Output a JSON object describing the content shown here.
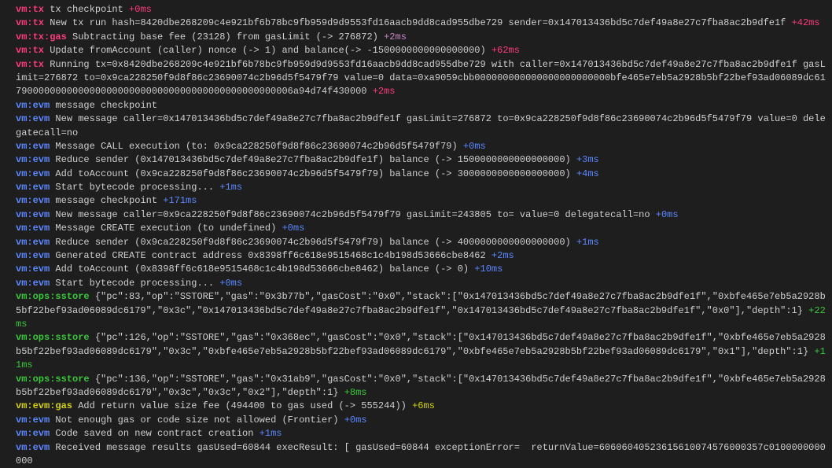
{
  "lines": [
    {
      "tag": "vm:tx",
      "tagClass": "tag-vmtx",
      "text": "tx checkpoint",
      "time": "+0ms",
      "timeClass": "t-red",
      "indent": true
    },
    {
      "tag": "vm:tx",
      "tagClass": "tag-vmtx",
      "text": "New tx run hash=8420dbe268209c4e921bf6b78bc9fb959d9d9553fd16aacb9dd8cad955dbe729 sender=0x147013436bd5c7def49a8e27c7fba8ac2b9dfe1f",
      "time": "+42ms",
      "timeClass": "t-red",
      "indent": true
    },
    {
      "tag": "vm:tx:gas",
      "tagClass": "tag-vmtxgas",
      "text": "Subtracting base fee (23128) from gasLimit (-> 276872)",
      "time": "+2ms",
      "timeClass": "t-magenta",
      "indent": true
    },
    {
      "tag": "vm:tx",
      "tagClass": "tag-vmtx",
      "text": "Update fromAccount (caller) nonce (-> 1) and balance(-> -1500000000000000000)",
      "time": "+62ms",
      "timeClass": "t-red",
      "indent": true
    },
    {
      "tag": "vm:tx",
      "tagClass": "tag-vmtx",
      "text": "Running tx=0x8420dbe268209c4e921bf6b78bc9fb959d9d9553fd16aacb9dd8cad955dbe729 with caller=0x147013436bd5c7def49a8e27c7fba8ac2b9dfe1f gasLimit=276872 to=0x9ca228250f9d8f86c23690074c2b96d5f5479f79 value=0 data=0xa9059cbb000000000000000000000000bfe465e7eb5a2928b5bf22bef93ad06089dc617900000000000000000000000000000000000000000000006a94d74f430000",
      "time": "+2ms",
      "timeClass": "t-red",
      "indent": true
    },
    {
      "tag": "vm:evm",
      "tagClass": "tag-vmevm",
      "text": "message checkpoint",
      "time": "",
      "timeClass": "",
      "indent": true
    },
    {
      "tag": "vm:evm",
      "tagClass": "tag-vmevm",
      "text": "New message caller=0x147013436bd5c7def49a8e27c7fba8ac2b9dfe1f gasLimit=276872 to=0x9ca228250f9d8f86c23690074c2b96d5f5479f79 value=0 delegatecall=no",
      "time": "",
      "timeClass": "",
      "indent": true
    },
    {
      "tag": "vm:evm",
      "tagClass": "tag-vmevm",
      "text": "Message CALL execution (to: 0x9ca228250f9d8f86c23690074c2b96d5f5479f79)",
      "time": "+0ms",
      "timeClass": "t-blue",
      "indent": true
    },
    {
      "tag": "vm:evm",
      "tagClass": "tag-vmevm",
      "text": "Reduce sender (0x147013436bd5c7def49a8e27c7fba8ac2b9dfe1f) balance (-> 1500000000000000000)",
      "time": "+3ms",
      "timeClass": "t-blue",
      "indent": true
    },
    {
      "tag": "vm:evm",
      "tagClass": "tag-vmevm",
      "text": "Add toAccount (0x9ca228250f9d8f86c23690074c2b96d5f5479f79) balance (-> 3000000000000000000)",
      "time": "+4ms",
      "timeClass": "t-blue",
      "indent": true
    },
    {
      "tag": "vm:evm",
      "tagClass": "tag-vmevm",
      "text": "Start bytecode processing...",
      "time": "+1ms",
      "timeClass": "t-blue",
      "indent": true
    },
    {
      "tag": "vm:evm",
      "tagClass": "tag-vmevm",
      "text": "message checkpoint",
      "time": "+171ms",
      "timeClass": "t-blue",
      "indent": true
    },
    {
      "tag": "vm:evm",
      "tagClass": "tag-vmevm",
      "text": "New message caller=0x9ca228250f9d8f86c23690074c2b96d5f5479f79 gasLimit=243805 to= value=0 delegatecall=no",
      "time": "+0ms",
      "timeClass": "t-blue",
      "indent": true
    },
    {
      "tag": "vm:evm",
      "tagClass": "tag-vmevm",
      "text": "Message CREATE execution (to undefined)",
      "time": "+0ms",
      "timeClass": "t-blue",
      "indent": true
    },
    {
      "tag": "vm:evm",
      "tagClass": "tag-vmevm",
      "text": "Reduce sender (0x9ca228250f9d8f86c23690074c2b96d5f5479f79) balance (-> 4000000000000000000)",
      "time": "+1ms",
      "timeClass": "t-blue",
      "indent": true
    },
    {
      "tag": "vm:evm",
      "tagClass": "tag-vmevm",
      "text": "Generated CREATE contract address 0x8398ff6c618e9515468c1c4b198d53666cbe8462",
      "time": "+2ms",
      "timeClass": "t-blue",
      "indent": true
    },
    {
      "tag": "vm:evm",
      "tagClass": "tag-vmevm",
      "text": "Add toAccount (0x8398ff6c618e9515468c1c4b198d53666cbe8462) balance (-> 0)",
      "time": "+10ms",
      "timeClass": "t-blue",
      "indent": true
    },
    {
      "tag": "vm:evm",
      "tagClass": "tag-vmevm",
      "text": "Start bytecode processing...",
      "time": "+0ms",
      "timeClass": "t-blue",
      "indent": true
    },
    {
      "tag": "vm:ops:sstore",
      "tagClass": "tag-vmopssstore",
      "text": "{\"pc\":83,\"op\":\"SSTORE\",\"gas\":\"0x3b77b\",\"gasCost\":\"0x0\",\"stack\":[\"0x147013436bd5c7def49a8e27c7fba8ac2b9dfe1f\",\"0xbfe465e7eb5a2928b5bf22bef93ad06089dc6179\",\"0x3c\",\"0x147013436bd5c7def49a8e27c7fba8ac2b9dfe1f\",\"0x147013436bd5c7def49a8e27c7fba8ac2b9dfe1f\",\"0x0\"],\"depth\":1}",
      "time": "+22ms",
      "timeClass": "t-green",
      "indent": true
    },
    {
      "tag": "vm:ops:sstore",
      "tagClass": "tag-vmopssstore",
      "text": "{\"pc\":126,\"op\":\"SSTORE\",\"gas\":\"0x368ec\",\"gasCost\":\"0x0\",\"stack\":[\"0x147013436bd5c7def49a8e27c7fba8ac2b9dfe1f\",\"0xbfe465e7eb5a2928b5bf22bef93ad06089dc6179\",\"0x3c\",\"0xbfe465e7eb5a2928b5bf22bef93ad06089dc6179\",\"0xbfe465e7eb5a2928b5bf22bef93ad06089dc6179\",\"0x1\"],\"depth\":1}",
      "time": "+11ms",
      "timeClass": "t-green",
      "indent": true
    },
    {
      "tag": "vm:ops:sstore",
      "tagClass": "tag-vmopssstore",
      "text": "{\"pc\":136,\"op\":\"SSTORE\",\"gas\":\"0x31ab9\",\"gasCost\":\"0x0\",\"stack\":[\"0x147013436bd5c7def49a8e27c7fba8ac2b9dfe1f\",\"0xbfe465e7eb5a2928b5bf22bef93ad06089dc6179\",\"0x3c\",\"0x3c\",\"0x2\"],\"depth\":1}",
      "time": "+8ms",
      "timeClass": "t-green",
      "indent": true
    },
    {
      "tag": "vm:evm:gas",
      "tagClass": "tag-vmevmgas",
      "text": "Add return value size fee (494400 to gas used (-> 555244))",
      "time": "+6ms",
      "timeClass": "t-yellow",
      "indent": true
    },
    {
      "tag": "vm:evm",
      "tagClass": "tag-vmevm",
      "text": "Not enough gas or code size not allowed (Frontier)",
      "time": "+0ms",
      "timeClass": "t-blue",
      "indent": true
    },
    {
      "tag": "vm:evm",
      "tagClass": "tag-vmevm",
      "text": "Code saved on new contract creation",
      "time": "+1ms",
      "timeClass": "t-blue",
      "indent": true
    },
    {
      "tag": "vm:evm",
      "tagClass": "tag-vmevm",
      "text": "Received message results gasUsed=60844 execResult: [ gasUsed=60844 exceptionError=  returnValue=60606040523615610074576000357c0100000000000",
      "time": "",
      "timeClass": "",
      "indent": true
    }
  ]
}
